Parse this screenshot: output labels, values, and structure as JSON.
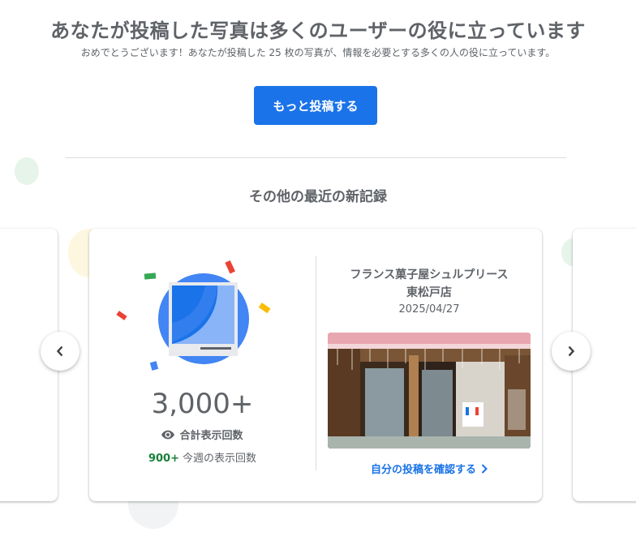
{
  "header": {
    "title": "あなたが投稿した写真は多くのユーザーの役に立っています",
    "subtitle": "おめでとうございます！あなたが投稿した 25 枚の写真が、情報を必要とする多くの人の役に立っています。"
  },
  "cta": {
    "label": "もっと投稿する"
  },
  "section": {
    "title": "その他の最近の新記録"
  },
  "card": {
    "total_views": "3,000+",
    "total_views_label": "合計表示回数",
    "weekly_views": "900+",
    "weekly_views_label": "今週の表示回数",
    "place_name_line1": "フランス菓子屋シュルプリース",
    "place_name_line2": "東松戸店",
    "date": "2025/04/27",
    "link_label": "自分の投稿を確認する"
  },
  "icons": {
    "view": "eye-icon",
    "prev": "chevron-left-icon",
    "next": "chevron-right-icon",
    "link_chevron": "chevron-right-icon"
  },
  "colors": {
    "accent": "#1a73e8",
    "positive": "#188038",
    "text": "#5f6368"
  }
}
